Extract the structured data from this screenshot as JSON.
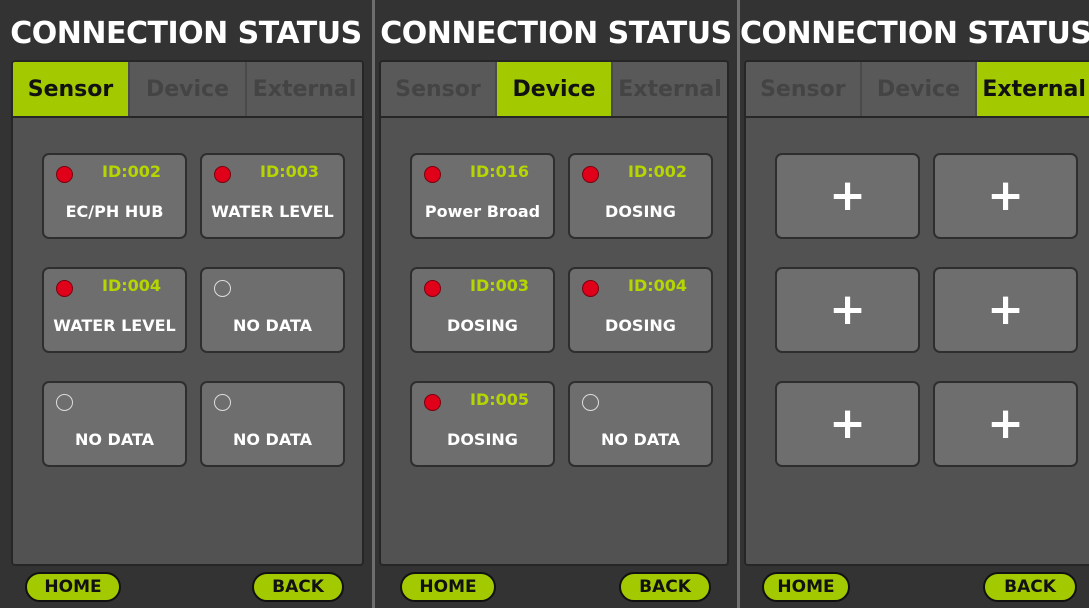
{
  "colors": {
    "accent": "#a3c900",
    "id_text": "#b5d600",
    "status_red": "#e0001a",
    "panel_bg": "#333333",
    "content_bg": "#525252",
    "card_bg": "#6e6e6e"
  },
  "panels": [
    {
      "title": "CONNECTION STATUS",
      "tabs": [
        {
          "label": "Sensor",
          "active": true
        },
        {
          "label": "Device",
          "active": false
        },
        {
          "label": "External",
          "active": false
        }
      ],
      "cards": [
        {
          "status": "red",
          "id": "ID:002",
          "name": "EC/PH HUB"
        },
        {
          "status": "red",
          "id": "ID:003",
          "name": "WATER LEVEL"
        },
        {
          "status": "red",
          "id": "ID:004",
          "name": "WATER LEVEL"
        },
        {
          "status": "off",
          "id": "",
          "name": "NO DATA"
        },
        {
          "status": "off",
          "id": "",
          "name": "NO DATA"
        },
        {
          "status": "off",
          "id": "",
          "name": "NO DATA"
        }
      ],
      "home_label": "HOME",
      "back_label": "BACK"
    },
    {
      "title": "CONNECTION STATUS",
      "tabs": [
        {
          "label": "Sensor",
          "active": false
        },
        {
          "label": "Device",
          "active": true
        },
        {
          "label": "External",
          "active": false
        }
      ],
      "cards": [
        {
          "status": "red",
          "id": "ID:016",
          "name": "Power Broad"
        },
        {
          "status": "red",
          "id": "ID:002",
          "name": "DOSING"
        },
        {
          "status": "red",
          "id": "ID:003",
          "name": "DOSING"
        },
        {
          "status": "red",
          "id": "ID:004",
          "name": "DOSING"
        },
        {
          "status": "red",
          "id": "ID:005",
          "name": "DOSING"
        },
        {
          "status": "off",
          "id": "",
          "name": "NO DATA"
        }
      ],
      "home_label": "HOME",
      "back_label": "BACK"
    },
    {
      "title": "CONNECTION STATUS",
      "tabs": [
        {
          "label": "Sensor",
          "active": false
        },
        {
          "label": "Device",
          "active": false
        },
        {
          "label": "External",
          "active": true
        }
      ],
      "cards": [
        {
          "status": "add",
          "label": "+"
        },
        {
          "status": "add",
          "label": "+"
        },
        {
          "status": "add",
          "label": "+"
        },
        {
          "status": "add",
          "label": "+"
        },
        {
          "status": "add",
          "label": "+"
        },
        {
          "status": "add",
          "label": "+"
        }
      ],
      "home_label": "HOME",
      "back_label": "BACK"
    }
  ]
}
